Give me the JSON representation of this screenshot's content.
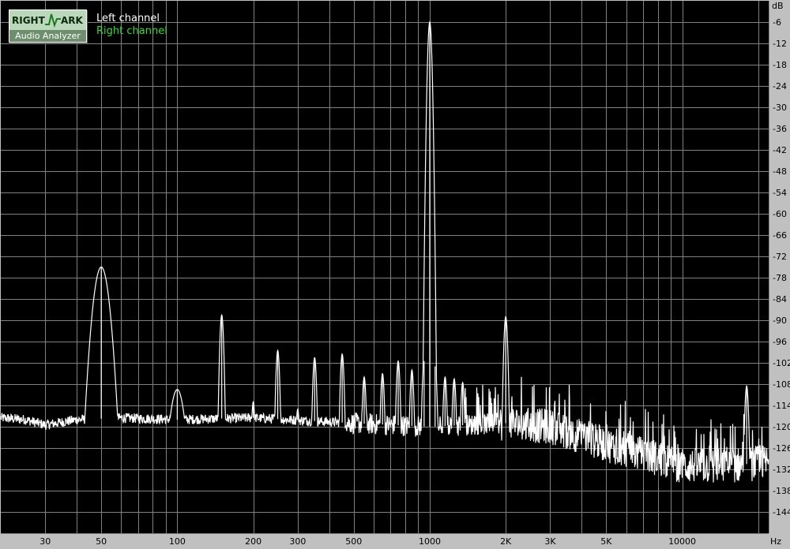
{
  "logo": {
    "word1": "RIGHT",
    "word2": "ARK",
    "subtitle": "Audio Analyzer"
  },
  "legend": [
    {
      "label": "Left channel",
      "color": "#ffffff"
    },
    {
      "label": "Right channel",
      "color": "#33dd33"
    }
  ],
  "colors": {
    "background": "#000000",
    "grid": "#808080",
    "frame": "#c0c0c0",
    "trace": "#ffffff"
  },
  "chart_data": {
    "type": "line",
    "title": "",
    "xlabel": "Hz",
    "ylabel": "dB",
    "x_scale": "log",
    "xlim": [
      20,
      22000
    ],
    "ylim": [
      -150,
      0
    ],
    "grid": true,
    "legend_position": "top-left",
    "x_ticks": [
      {
        "value": 30,
        "label": "30"
      },
      {
        "value": 50,
        "label": "50"
      },
      {
        "value": 100,
        "label": "100"
      },
      {
        "value": 200,
        "label": "200"
      },
      {
        "value": 300,
        "label": "300"
      },
      {
        "value": 500,
        "label": "500"
      },
      {
        "value": 1000,
        "label": "1000"
      },
      {
        "value": 2000,
        "label": "2K"
      },
      {
        "value": 3000,
        "label": "3K"
      },
      {
        "value": 5000,
        "label": "5K"
      },
      {
        "value": 10000,
        "label": "10000"
      }
    ],
    "y_ticks": [
      -6,
      -12,
      -18,
      -24,
      -30,
      -36,
      -42,
      -48,
      -54,
      -60,
      -66,
      -72,
      -78,
      -84,
      -90,
      -96,
      -102,
      -108,
      -114,
      -120,
      -126,
      -132,
      -138,
      -144
    ],
    "series": [
      {
        "name": "Left channel",
        "color": "#ffffff",
        "noise_floor": [
          [
            20,
            -117.5
          ],
          [
            25,
            -118
          ],
          [
            30,
            -119.5
          ],
          [
            40,
            -118
          ],
          [
            60,
            -117.5
          ],
          [
            100,
            -118
          ],
          [
            200,
            -117.5
          ],
          [
            500,
            -119
          ],
          [
            1000,
            -120
          ],
          [
            2000,
            -119
          ],
          [
            3000,
            -120
          ],
          [
            5000,
            -125
          ],
          [
            8000,
            -129
          ],
          [
            10000,
            -131
          ],
          [
            15000,
            -131
          ],
          [
            22000,
            -130
          ]
        ],
        "peaks": [
          {
            "x": 50,
            "y": -75
          },
          {
            "x": 100,
            "y": -109.5
          },
          {
            "x": 150,
            "y": -88.5
          },
          {
            "x": 200,
            "y": -113
          },
          {
            "x": 250,
            "y": -98.5
          },
          {
            "x": 300,
            "y": -115
          },
          {
            "x": 350,
            "y": -100.5
          },
          {
            "x": 450,
            "y": -99.5
          },
          {
            "x": 550,
            "y": -106
          },
          {
            "x": 650,
            "y": -105
          },
          {
            "x": 750,
            "y": -101.5
          },
          {
            "x": 850,
            "y": -104
          },
          {
            "x": 950,
            "y": -101.5
          },
          {
            "x": 1000,
            "y": -6
          },
          {
            "x": 1050,
            "y": -103
          },
          {
            "x": 1150,
            "y": -106
          },
          {
            "x": 1250,
            "y": -106.5
          },
          {
            "x": 1350,
            "y": -107.5
          },
          {
            "x": 2000,
            "y": -89
          },
          {
            "x": 18000,
            "y": -108.5
          }
        ]
      }
    ]
  }
}
